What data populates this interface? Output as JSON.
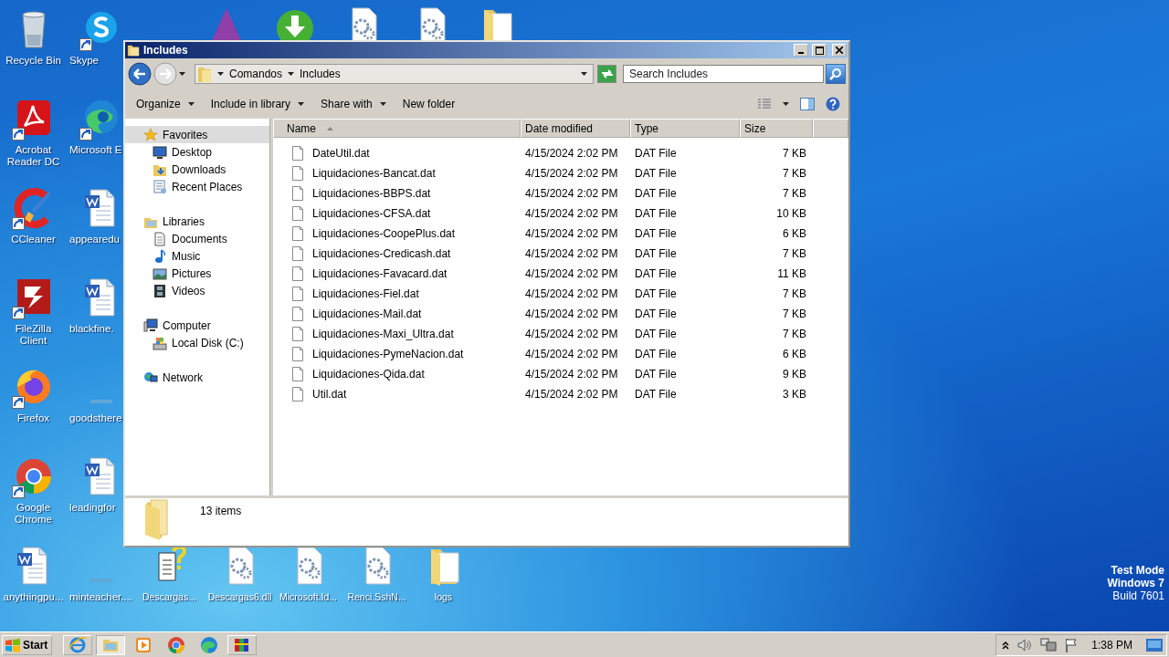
{
  "desktop": {
    "top_row": [
      {
        "kind": "triangle"
      },
      {
        "kind": "download"
      },
      {
        "kind": "gear"
      },
      {
        "kind": "gear"
      },
      {
        "kind": "folder"
      }
    ],
    "first_column": [
      {
        "kind": "recycle",
        "label": "Recycle Bin",
        "shortcut": false
      },
      {
        "kind": "acrobat",
        "label": "Acrobat Reader DC",
        "shortcut": true
      },
      {
        "kind": "ccleaner",
        "label": "CCleaner",
        "shortcut": true
      },
      {
        "kind": "filezilla",
        "label": "FileZilla Client",
        "shortcut": true
      },
      {
        "kind": "firefox",
        "label": "Firefox",
        "shortcut": true
      },
      {
        "kind": "chrome",
        "label": "Google Chrome",
        "shortcut": true
      },
      {
        "kind": "word",
        "label": "anythingpu...",
        "shortcut": false
      }
    ],
    "second_column": [
      {
        "kind": "skype",
        "label": "Skype",
        "shortcut": true
      },
      {
        "kind": "edge",
        "label": "Microsoft E",
        "shortcut": true
      },
      {
        "kind": "word",
        "label": "appearedu",
        "shortcut": false
      },
      {
        "kind": "word",
        "label": "blackfine.",
        "shortcut": false
      },
      {
        "kind": "blank",
        "label": "goodsthere",
        "shortcut": false
      },
      {
        "kind": "word",
        "label": "leadingfor",
        "shortcut": false
      },
      {
        "kind": "blank",
        "label": "minteacher....",
        "shortcut": false
      }
    ],
    "bottom_row": [
      {
        "kind": "unknown",
        "label": "Descargas...",
        "shortcut": false
      },
      {
        "kind": "gear",
        "label": "Descargas6.dll",
        "shortcut": false
      },
      {
        "kind": "gear",
        "label": "Microsoft.Id...",
        "shortcut": false
      },
      {
        "kind": "gear",
        "label": "Renci.SshN...",
        "shortcut": false
      },
      {
        "kind": "folder",
        "label": "logs",
        "shortcut": false
      }
    ]
  },
  "window": {
    "title": "Includes",
    "address": {
      "crumbs": [
        "Comandos",
        "Includes"
      ],
      "search_placeholder": "Search Includes"
    },
    "toolbar": [
      {
        "label": "Organize",
        "has_menu": true
      },
      {
        "label": "Include in library",
        "has_menu": true
      },
      {
        "label": "Share with",
        "has_menu": true
      },
      {
        "label": "New folder",
        "has_menu": false
      }
    ],
    "navigation": [
      {
        "kind": "favorites",
        "label": "Favorites",
        "selected": true,
        "children": [
          {
            "kind": "desktop",
            "label": "Desktop",
            "selected": false
          },
          {
            "kind": "downloads",
            "label": "Downloads",
            "selected": false
          },
          {
            "kind": "recent",
            "label": "Recent Places",
            "selected": false
          }
        ]
      },
      {
        "kind": "libraries",
        "label": "Libraries",
        "selected": false,
        "children": [
          {
            "kind": "documents",
            "label": "Documents",
            "selected": false
          },
          {
            "kind": "music",
            "label": "Music",
            "selected": false
          },
          {
            "kind": "pictures",
            "label": "Pictures",
            "selected": false
          },
          {
            "kind": "videos",
            "label": "Videos",
            "selected": false
          }
        ]
      },
      {
        "kind": "computer",
        "label": "Computer",
        "selected": false,
        "children": [
          {
            "kind": "disk",
            "label": "Local Disk (C:)",
            "selected": false
          }
        ]
      },
      {
        "kind": "network",
        "label": "Network",
        "selected": false
      }
    ],
    "columns": [
      {
        "label": "Name",
        "sorted": true
      },
      {
        "label": "Date modified",
        "sorted": false
      },
      {
        "label": "Type",
        "sorted": false
      },
      {
        "label": "Size",
        "sorted": false
      }
    ],
    "files": [
      {
        "name": "DateUtil.dat",
        "date": "4/15/2024 2:02 PM",
        "type": "DAT File",
        "size": "7 KB",
        "selected": false
      },
      {
        "name": "Liquidaciones-Bancat.dat",
        "date": "4/15/2024 2:02 PM",
        "type": "DAT File",
        "size": "7 KB",
        "selected": false
      },
      {
        "name": "Liquidaciones-BBPS.dat",
        "date": "4/15/2024 2:02 PM",
        "type": "DAT File",
        "size": "7 KB",
        "selected": false
      },
      {
        "name": "Liquidaciones-CFSA.dat",
        "date": "4/15/2024 2:02 PM",
        "type": "DAT File",
        "size": "10 KB",
        "selected": false
      },
      {
        "name": "Liquidaciones-CoopePlus.dat",
        "date": "4/15/2024 2:02 PM",
        "type": "DAT File",
        "size": "6 KB",
        "selected": false
      },
      {
        "name": "Liquidaciones-Credicash.dat",
        "date": "4/15/2024 2:02 PM",
        "type": "DAT File",
        "size": "7 KB",
        "selected": false
      },
      {
        "name": "Liquidaciones-Favacard.dat",
        "date": "4/15/2024 2:02 PM",
        "type": "DAT File",
        "size": "11 KB",
        "selected": false
      },
      {
        "name": "Liquidaciones-Fiel.dat",
        "date": "4/15/2024 2:02 PM",
        "type": "DAT File",
        "size": "7 KB",
        "selected": false
      },
      {
        "name": "Liquidaciones-Mail.dat",
        "date": "4/15/2024 2:02 PM",
        "type": "DAT File",
        "size": "7 KB",
        "selected": false
      },
      {
        "name": "Liquidaciones-Maxi_Ultra.dat",
        "date": "4/15/2024 2:02 PM",
        "type": "DAT File",
        "size": "7 KB",
        "selected": false
      },
      {
        "name": "Liquidaciones-PymeNacion.dat",
        "date": "4/15/2024 2:02 PM",
        "type": "DAT File",
        "size": "6 KB",
        "selected": false
      },
      {
        "name": "Liquidaciones-Qida.dat",
        "date": "4/15/2024 2:02 PM",
        "type": "DAT File",
        "size": "9 KB",
        "selected": false
      },
      {
        "name": "Util.dat",
        "date": "4/15/2024 2:02 PM",
        "type": "DAT File",
        "size": "3 KB",
        "selected": false
      }
    ],
    "status": "13 items"
  },
  "os_notice": [
    "Test Mode",
    "Windows 7",
    "Build 7601"
  ],
  "taskbar": {
    "start": "Start",
    "items": [
      {
        "kind": "ie",
        "selected": false,
        "running": true
      },
      {
        "kind": "explorer",
        "selected": true,
        "running": true
      },
      {
        "kind": "media",
        "selected": false,
        "running": false
      },
      {
        "kind": "chrome",
        "selected": false,
        "running": false
      },
      {
        "kind": "edge",
        "selected": false,
        "running": false
      },
      {
        "kind": "winrar",
        "selected": false,
        "running": true
      }
    ],
    "clock": "1:38 PM"
  }
}
